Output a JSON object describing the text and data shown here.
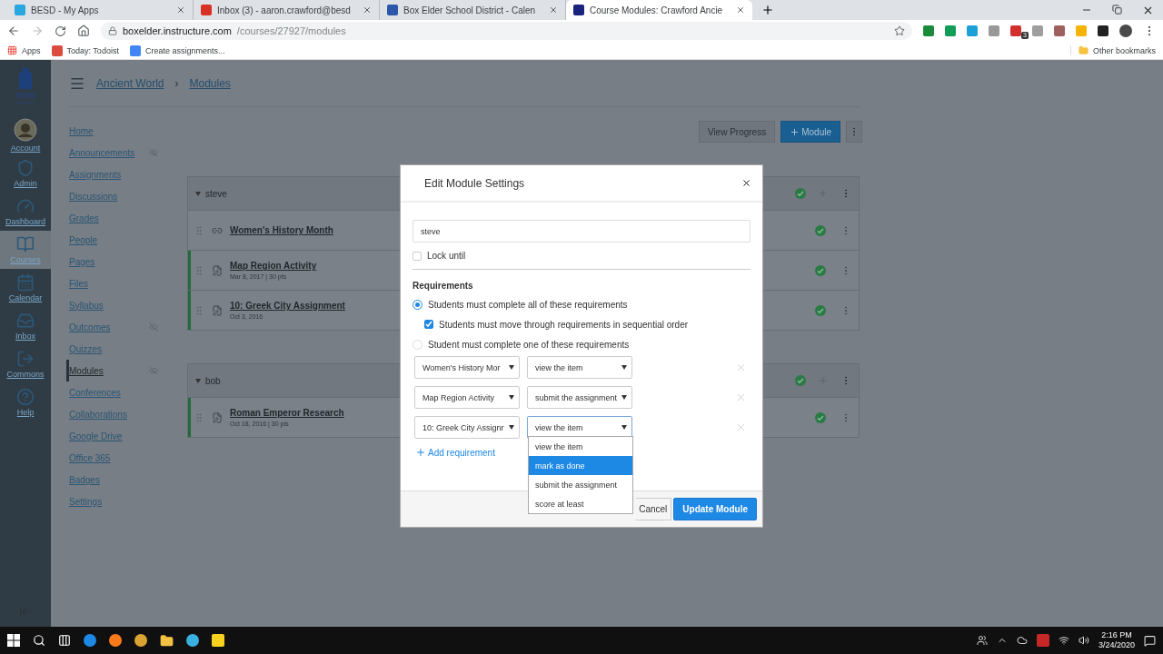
{
  "browser": {
    "tabs": [
      {
        "title": "BESD - My Apps",
        "selected": false
      },
      {
        "title": "Inbox (3) - aaron.crawford@besd",
        "selected": false
      },
      {
        "title": "Box Elder School District - Calen",
        "selected": false
      },
      {
        "title": "Course Modules: Crawford Ancie",
        "selected": true
      }
    ],
    "url": {
      "host": "boxelder.instructure.com",
      "path": "/courses/27927/modules"
    },
    "extension_badge": "3",
    "bookmarks": [
      "Apps",
      "Today: Todoist",
      "Create assignments..."
    ],
    "other_bookmarks": "Other bookmarks"
  },
  "global_nav": [
    {
      "label": "Account",
      "selected": false
    },
    {
      "label": "Admin",
      "selected": false
    },
    {
      "label": "Dashboard",
      "selected": false
    },
    {
      "label": "Courses",
      "selected": true
    },
    {
      "label": "Calendar",
      "selected": false
    },
    {
      "label": "Inbox",
      "selected": false
    },
    {
      "label": "Commons",
      "selected": false
    },
    {
      "label": "Help",
      "selected": false
    }
  ],
  "breadcrumb": [
    "Ancient World",
    "Modules"
  ],
  "breadcrumb_separator": "›",
  "course_nav": [
    {
      "label": "Home",
      "selected": false,
      "hidden": false
    },
    {
      "label": "Announcements",
      "selected": false,
      "hidden": true
    },
    {
      "label": "Assignments",
      "selected": false,
      "hidden": false
    },
    {
      "label": "Discussions",
      "selected": false,
      "hidden": false
    },
    {
      "label": "Grades",
      "selected": false,
      "hidden": false
    },
    {
      "label": "People",
      "selected": false,
      "hidden": false
    },
    {
      "label": "Pages",
      "selected": false,
      "hidden": false
    },
    {
      "label": "Files",
      "selected": false,
      "hidden": false
    },
    {
      "label": "Syllabus",
      "selected": false,
      "hidden": false
    },
    {
      "label": "Outcomes",
      "selected": false,
      "hidden": true
    },
    {
      "label": "Quizzes",
      "selected": false,
      "hidden": false
    },
    {
      "label": "Modules",
      "selected": true,
      "hidden": true
    },
    {
      "label": "Conferences",
      "selected": false,
      "hidden": false
    },
    {
      "label": "Collaborations",
      "selected": false,
      "hidden": false
    },
    {
      "label": "Google Drive",
      "selected": false,
      "hidden": false
    },
    {
      "label": "Office 365",
      "selected": false,
      "hidden": false
    },
    {
      "label": "Badges",
      "selected": false,
      "hidden": false
    },
    {
      "label": "Settings",
      "selected": false,
      "hidden": false
    }
  ],
  "toolbar": {
    "view_progress": "View Progress",
    "add_module": "Module"
  },
  "modules": [
    {
      "name": "steve",
      "items": [
        {
          "kind": "link",
          "title": "Women's History Month"
        },
        {
          "kind": "assignment",
          "title": "Map Region Activity",
          "meta": "Mar 8, 2017 | 30 pts"
        },
        {
          "kind": "assignment",
          "title": "10: Greek City Assignment",
          "meta": "Oct 3, 2016"
        }
      ]
    },
    {
      "name": "bob",
      "items": [
        {
          "kind": "assignment",
          "title": "Roman Emperor Research",
          "meta": "Oct 18, 2016 | 30 pts"
        }
      ]
    }
  ],
  "dialog": {
    "title": "Edit Module Settings",
    "name": "steve",
    "lock_until": {
      "label": "Lock until",
      "checked": false
    },
    "requirements_heading": "Requirements",
    "completion_options": [
      {
        "label": "Students must complete all of these requirements",
        "selected": true
      },
      {
        "label": "Student must complete one of these requirements",
        "selected": false
      }
    ],
    "sequential": {
      "label": "Students must move through requirements in sequential order",
      "checked": true
    },
    "requirements": [
      {
        "item": "Women's History Mor",
        "type": "view the item",
        "focused": false
      },
      {
        "item": "Map Region Activity",
        "type": "submit the assignment",
        "focused": false
      },
      {
        "item": "10: Greek City Assignr",
        "type": "view the item",
        "focused": true
      }
    ],
    "add_requirement": "Add requirement",
    "open_menu": [
      {
        "label": "view the item",
        "selected": false
      },
      {
        "label": "mark as done",
        "selected": true
      },
      {
        "label": "submit the assignment",
        "selected": false
      },
      {
        "label": "score at least",
        "selected": false
      }
    ],
    "cancel": "Cancel",
    "submit": "Update Module"
  },
  "taskbar": {
    "time": "2:16 PM",
    "date": "3/24/2020"
  }
}
